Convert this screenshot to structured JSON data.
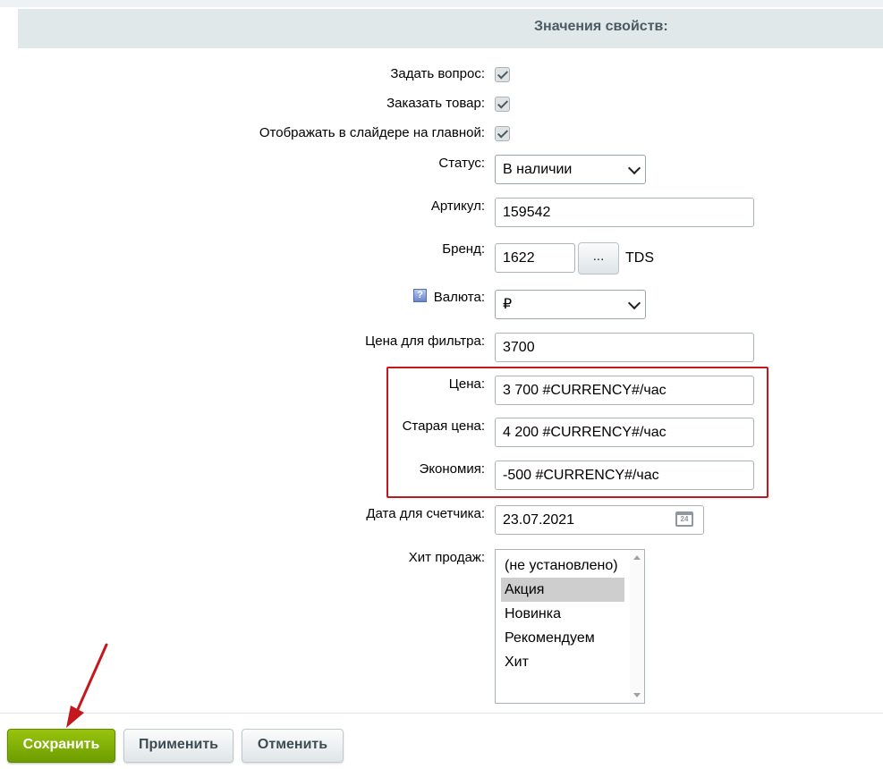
{
  "header": {
    "title": "Значения свойств:"
  },
  "properties": {
    "ask_question": {
      "label": "Задать вопрос:",
      "checked": true
    },
    "order_item": {
      "label": "Заказать товар:",
      "checked": true
    },
    "show_in_slider": {
      "label": "Отображать в слайдере на главной:",
      "checked": true
    },
    "status": {
      "label": "Статус:",
      "value": "В наличии"
    },
    "article": {
      "label": "Артикул:",
      "value": "159542"
    },
    "brand": {
      "label": "Бренд:",
      "value": "1622",
      "button": "...",
      "name": "TDS"
    },
    "currency": {
      "label": "Валюта:",
      "value": "₽",
      "help_icon": "?"
    },
    "filter_price": {
      "label": "Цена для фильтра:",
      "value": "3700"
    },
    "price": {
      "label": "Цена:",
      "value": "3 700 #CURRENCY#/час"
    },
    "old_price": {
      "label": "Старая цена:",
      "value": "4 200 #CURRENCY#/час"
    },
    "savings": {
      "label": "Экономия:",
      "value": "-500 #CURRENCY#/час"
    },
    "counter_date": {
      "label": "Дата для счетчика:",
      "value": "23.07.2021",
      "calendar_day": "24"
    },
    "bestseller": {
      "label": "Хит продаж:",
      "options": [
        "(не установлено)",
        "Акция",
        "Новинка",
        "Рекомендуем",
        "Хит"
      ],
      "selected": "Акция"
    }
  },
  "footer": {
    "save": "Сохранить",
    "apply": "Применить",
    "cancel": "Отменить"
  },
  "colors": {
    "highlight_border": "#c4181e",
    "save_button": "#7fae04",
    "arrow": "#c4181e"
  },
  "icons": {
    "checkbox": "checkmark-icon",
    "calendar": "calendar-icon",
    "help": "help-icon",
    "arrow": "red-arrow-annotation"
  }
}
